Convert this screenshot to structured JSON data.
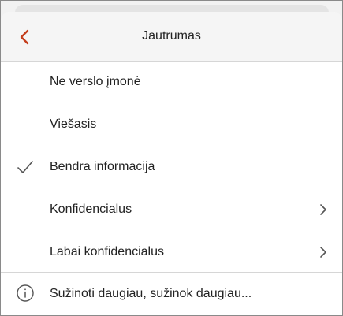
{
  "header": {
    "title": "Jautrumas",
    "back_icon": "chevron-left-icon",
    "accent_color": "#c43e1c"
  },
  "menu": {
    "items": [
      {
        "label": "Ne verslo įmonė",
        "checked": false,
        "has_submenu": false
      },
      {
        "label": "Viešasis",
        "checked": false,
        "has_submenu": false
      },
      {
        "label": "Bendra informacija",
        "checked": true,
        "has_submenu": false
      },
      {
        "label": "Konfidencialus",
        "checked": false,
        "has_submenu": true
      },
      {
        "label": "Labai konfidencialus",
        "checked": false,
        "has_submenu": true
      }
    ]
  },
  "footer": {
    "learn_more_label": "Sužinoti daugiau, sužinok daugiau...",
    "icon": "info-icon"
  }
}
